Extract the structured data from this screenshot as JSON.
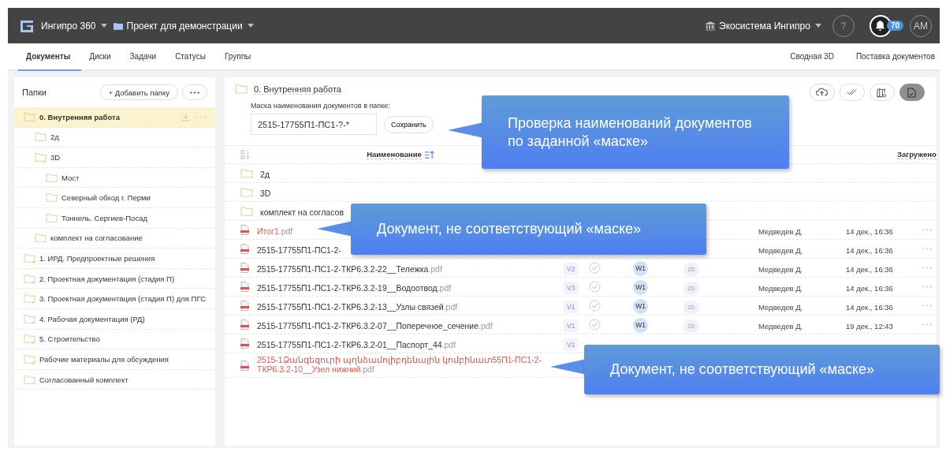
{
  "header": {
    "app_name": "Ингипро 360",
    "project": "Проект для демонстрации",
    "ecosystem": "Экосистема Ингипро",
    "help": "?",
    "notifications": "70",
    "avatar": "АМ"
  },
  "tabs": [
    {
      "label": "Документы",
      "selected": true
    },
    {
      "label": "Диски",
      "selected": false
    },
    {
      "label": "Задачи",
      "selected": false
    },
    {
      "label": "Статусы",
      "selected": false
    },
    {
      "label": "Группы",
      "selected": false
    }
  ],
  "right_links": [
    "Сводная 3D",
    "Поставка документов"
  ],
  "folders_panel": {
    "title": "Папки",
    "add_button": "+ Добавить папку"
  },
  "tree": [
    {
      "name": "0. Внутренняя работа",
      "selected": true,
      "expanded": true,
      "children": [
        {
          "name": "2д",
          "selected": false
        },
        {
          "name": "3D",
          "selected": false,
          "expanded": true,
          "children": [
            {
              "name": "Мост",
              "selected": false
            },
            {
              "name": "Северный обход г. Перми",
              "selected": false
            },
            {
              "name": "Тоннель. Сергиев-Посад",
              "selected": false
            }
          ]
        },
        {
          "name": "комплект на согласование",
          "selected": false
        }
      ]
    },
    {
      "name": "1. ИРД. Предпроектные решения",
      "selected": false,
      "expanded": false
    },
    {
      "name": "2. Проектная документация (стадия П)",
      "selected": false,
      "expanded": false
    },
    {
      "name": "3. Проектная документация (стадия П) для ПГС",
      "selected": false,
      "expanded": false
    },
    {
      "name": "4. Рабочая документация (РД)",
      "selected": false,
      "expanded": false
    },
    {
      "name": "5. Строительство",
      "selected": false,
      "expanded": false
    },
    {
      "name": "Рабочие материалы для обсуждения",
      "selected": false,
      "expanded": false
    },
    {
      "name": "Согласованный комплект",
      "selected": false
    }
  ],
  "documents": {
    "folder": "0. Внутренняя работа",
    "mask_label": "Маска наименования документов в папке:",
    "mask_value": "2515-17755П1-ПС1-?-*",
    "save_button": "Сохранить",
    "toolbar": [
      {
        "kind": "upload",
        "selected": false
      },
      {
        "kind": "approve",
        "selected": false
      },
      {
        "kind": "map",
        "selected": false
      },
      {
        "kind": "document",
        "selected": true
      }
    ],
    "name_column": "Наименование",
    "uploaded_column": "Загружено"
  },
  "rows": [
    {
      "kind": "folder",
      "name": "2д"
    },
    {
      "kind": "folder",
      "name": "3D"
    },
    {
      "kind": "folder",
      "name": "комплект на согласов"
    },
    {
      "kind": "file",
      "name": "Итог1",
      "ext": ".pdf",
      "mismatch": true,
      "author": "Медведев Д.",
      "date": "14 дек., 16:36"
    },
    {
      "kind": "file",
      "name": "2515-17755П1-ПС1-2-",
      "mismatch": false,
      "author": "Медведев Д.",
      "date": "14 дек., 16:36"
    },
    {
      "kind": "file",
      "name": "2515-17755П1-ПС1-2-ТКР6.3.2-22__Тележка",
      "ext": ".pdf",
      "mismatch": false,
      "version": "V2",
      "approved": true,
      "workflow": "W1",
      "view": "2D",
      "author": "Медведев Д.",
      "date": "14 дек., 16:36"
    },
    {
      "kind": "file",
      "name": "2515-17755П1-ПС1-2-ТКР6.3.2-19__Водоотвод",
      "ext": ".pdf",
      "mismatch": false,
      "version": "V3",
      "approved": true,
      "workflow": "W1",
      "view": "2D",
      "author": "Медведев Д.",
      "date": "14 дек., 16:36"
    },
    {
      "kind": "file",
      "name": "2515-17755П1-ПС1-2-ТКР6.3.2-13__Узлы связей",
      "ext": ".pdf",
      "mismatch": false,
      "version": "V1",
      "approved": true,
      "workflow": "W1",
      "view": "2D",
      "author": "Медведев Д.",
      "date": "14 дек., 16:36"
    },
    {
      "kind": "file",
      "name": "2515-17755П1-ПС1-2-ТКР6.3.2-07__Поперечное_сечение",
      "ext": ".pdf",
      "mismatch": false,
      "version": "V1",
      "approved": true,
      "workflow": "W1",
      "view": "2D",
      "author": "Медведев Д.",
      "date": "19 дек., 12:43"
    },
    {
      "kind": "file",
      "name": "2515-17755П1-ПС1-2-ТКР6.3.2-01__Паспорт_44",
      "ext": ".pdf",
      "mismatch": false,
      "version": "V1"
    },
    {
      "kind": "file",
      "name": "2515-1Ձանգեզուրի պղնձամոլիբդենային կոմբինատ55П1-ПС1-2-ТКР6.3.2-10__Узел нижний",
      "ext": ".pdf",
      "mismatch": true
    }
  ],
  "callouts": [
    {
      "text": "Проверка наименований документов по заданной «маске»"
    },
    {
      "text": "Документ, не соответствующий «маске»"
    },
    {
      "text": "Документ, не соответствующий «маске»"
    }
  ]
}
